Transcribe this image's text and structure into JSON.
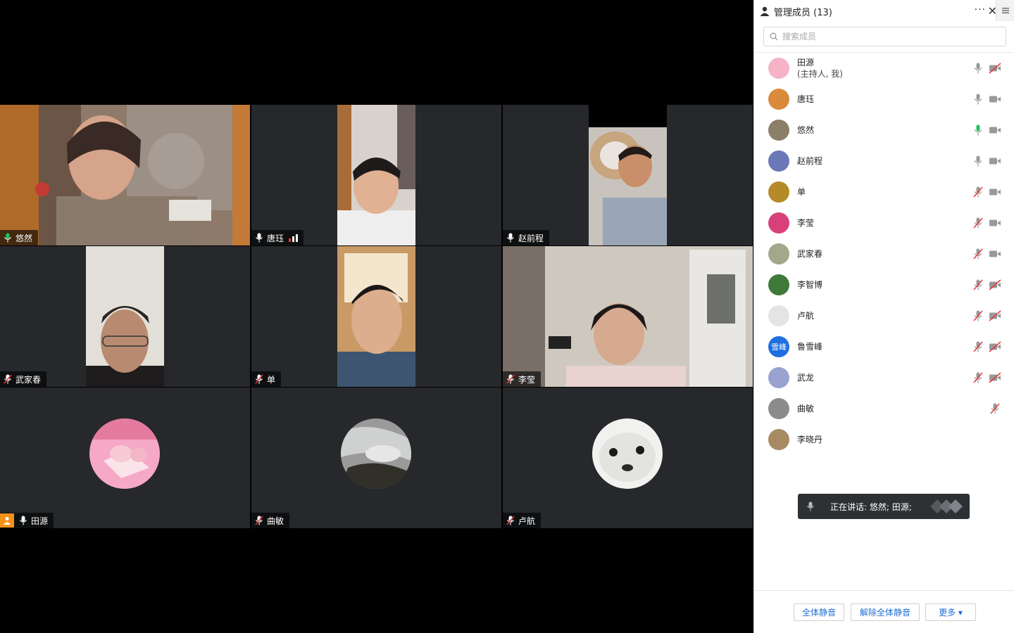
{
  "video_tiles": [
    {
      "name": "悠然",
      "mic": "on",
      "active": true,
      "video": "on"
    },
    {
      "name": "唐珏",
      "mic": "on",
      "active": false,
      "video": "on",
      "signal": "weak"
    },
    {
      "name": "赵前程",
      "mic": "on",
      "active": false,
      "video": "on"
    },
    {
      "name": "武家春",
      "mic": "muted",
      "active": false,
      "video": "on"
    },
    {
      "name": "单",
      "mic": "muted",
      "active": false,
      "video": "on"
    },
    {
      "name": "李莹",
      "mic": "muted",
      "active": false,
      "video": "on"
    },
    {
      "name": "田源",
      "mic": "on",
      "active": false,
      "video": "off",
      "host": true
    },
    {
      "name": "曲敏",
      "mic": "muted",
      "active": false,
      "video": "off"
    },
    {
      "name": "卢航",
      "mic": "muted",
      "active": false,
      "video": "off"
    }
  ],
  "sidebar": {
    "title": "管理成员 (13)",
    "more_label": "···",
    "close_label": "✕",
    "search_placeholder": "搜索成员",
    "members": [
      {
        "name": "田源",
        "sub": "(主持人, 我)",
        "mic": "on",
        "cam": "off",
        "avatar_color": "#f6b3c8"
      },
      {
        "name": "唐珏",
        "mic": "on",
        "cam": "on",
        "avatar_color": "#d98a3a"
      },
      {
        "name": "悠然",
        "mic": "speaking",
        "cam": "on",
        "avatar_color": "#8b7f6a"
      },
      {
        "name": "赵前程",
        "mic": "on",
        "cam": "on",
        "avatar_color": "#6a78b8"
      },
      {
        "name": "单",
        "mic": "muted",
        "cam": "on",
        "avatar_color": "#b58b2a"
      },
      {
        "name": "李莹",
        "mic": "muted",
        "cam": "on",
        "avatar_color": "#d9407a"
      },
      {
        "name": "武家春",
        "mic": "muted",
        "cam": "on",
        "avatar_color": "#a3a88a"
      },
      {
        "name": "李智博",
        "mic": "muted",
        "cam": "off",
        "avatar_color": "#3f7a3a"
      },
      {
        "name": "卢航",
        "mic": "muted",
        "cam": "off",
        "avatar_color": "#e4e4e4"
      },
      {
        "name": "鲁雪峰",
        "mic": "muted",
        "cam": "off",
        "avatar_text": "雪峰",
        "avatar_color": "#1f6fe0"
      },
      {
        "name": "武龙",
        "mic": "muted",
        "cam": "off",
        "avatar_color": "#9aa3cf"
      },
      {
        "name": "曲敏",
        "mic": "muted",
        "cam": "none",
        "avatar_color": "#8c8c8c"
      },
      {
        "name": "李晓丹",
        "mic": "none",
        "cam": "none",
        "avatar_color": "#a88a62"
      }
    ],
    "speaking_text": "正在讲话: 悠然; 田源;",
    "footer": {
      "mute_all": "全体静音",
      "unmute_all": "解除全体静音",
      "more": "更多 ▾"
    }
  },
  "colors": {
    "active_speaker": "#21c45d",
    "muted_red": "#e03a3a",
    "link_blue": "#1f6fd1",
    "host_orange": "#f39219"
  }
}
